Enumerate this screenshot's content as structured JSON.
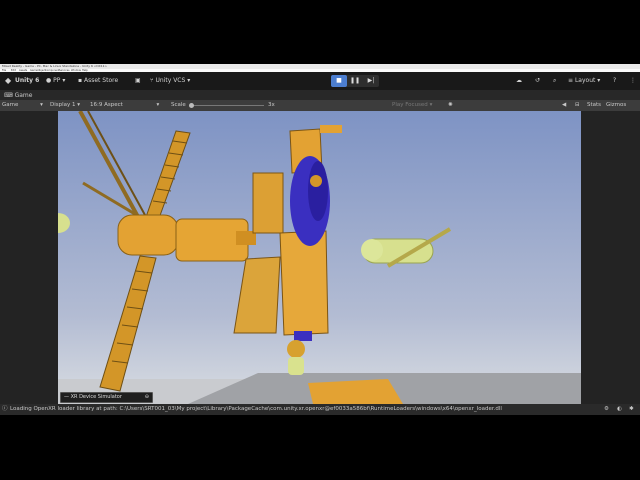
{
  "titlebar": {
    "text": "Mixed Reality - Game - PC, Mac & Linux Standalone - Unity 6 <DX11>"
  },
  "menubar": {
    "items": [
      "File",
      "Edit",
      "Assets",
      "GameObject",
      "Component",
      "Services",
      "Window",
      "Help"
    ]
  },
  "toolbar": {
    "unity_label": "Unity 6",
    "account_label": "PP",
    "asset_store_label": "Asset Store",
    "vcs_label": "Unity VCS",
    "layout_label": "Layout"
  },
  "tab": {
    "label": "Game"
  },
  "game_toolbar": {
    "mode": "Game",
    "display": "Display 1",
    "aspect": "16:9 Aspect",
    "scale_label": "Scale",
    "scale_value": "3x",
    "play_focused": "Play Focused",
    "stats": "Stats",
    "gizmos": "Gizmos"
  },
  "simulator": {
    "label": "XR Device Simulator"
  },
  "status": {
    "message": "Loading OpenXR loader library at path: C:\\Users\\SRT001_03\\My project\\Library\\PackageCache\\com.unity.xr.openxr@ef0033a586bf\\RuntimeLoaders\\windows\\x64\\openxr_loader.dll"
  },
  "colors": {
    "sky_top": "#7e93c4",
    "sky_bottom": "#d9dde2",
    "module": "#e3a233",
    "accent": "#3a2fc0",
    "capsule": "#d7e08e"
  }
}
